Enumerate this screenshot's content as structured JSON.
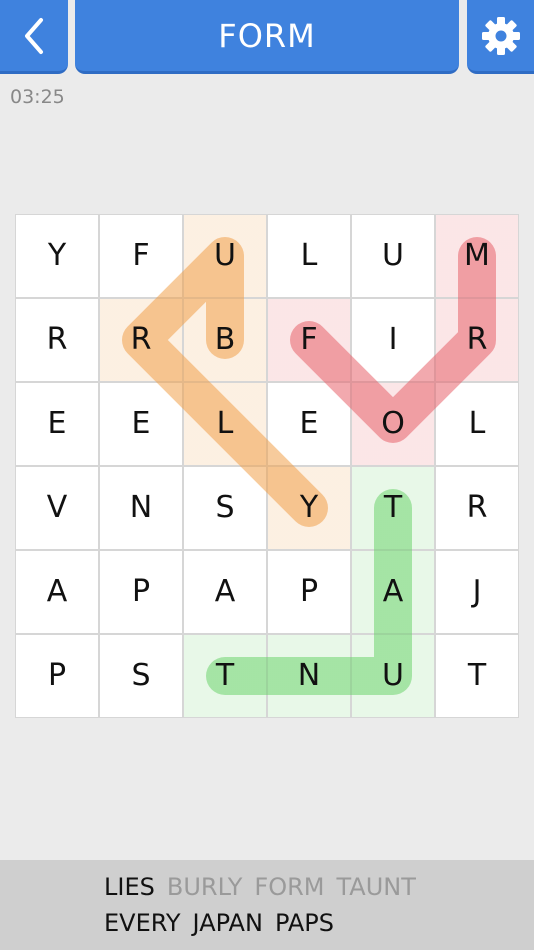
{
  "header": {
    "title": "FORM",
    "back_icon": "chevron-left-icon",
    "settings_icon": "gear-icon"
  },
  "timer": "03:25",
  "colors": {
    "accent": "#3f82de",
    "orange": "#f0a04b",
    "red": "#e8636b",
    "green": "#6ed36e"
  },
  "grid": [
    [
      "Y",
      "F",
      "U",
      "L",
      "U",
      "M"
    ],
    [
      "R",
      "R",
      "B",
      "F",
      "I",
      "R"
    ],
    [
      "E",
      "E",
      "L",
      "E",
      "O",
      "L"
    ],
    [
      "V",
      "N",
      "S",
      "Y",
      "T",
      "R"
    ],
    [
      "A",
      "P",
      "A",
      "P",
      "A",
      "J"
    ],
    [
      "P",
      "S",
      "T",
      "N",
      "U",
      "T"
    ]
  ],
  "found_paths": [
    {
      "word": "BURLY",
      "color": "#f0a04b",
      "cells": [
        [
          1,
          2
        ],
        [
          0,
          2
        ],
        [
          1,
          1
        ],
        [
          2,
          2
        ],
        [
          3,
          3
        ]
      ],
      "line": [
        [
          1,
          2
        ],
        [
          0,
          2
        ],
        [
          1,
          1
        ],
        [
          3,
          3
        ]
      ]
    },
    {
      "word": "FORM",
      "color": "#e8636b",
      "cells": [
        [
          1,
          3
        ],
        [
          2,
          4
        ],
        [
          1,
          5
        ],
        [
          0,
          5
        ]
      ],
      "line": [
        [
          1,
          3
        ],
        [
          2,
          4
        ],
        [
          1,
          5
        ],
        [
          0,
          5
        ]
      ]
    },
    {
      "word": "TAUNT",
      "color": "#6ed36e",
      "cells": [
        [
          3,
          4
        ],
        [
          4,
          4
        ],
        [
          5,
          4
        ],
        [
          5,
          3
        ],
        [
          5,
          2
        ]
      ],
      "line": [
        [
          3,
          4
        ],
        [
          5,
          4
        ],
        [
          5,
          2
        ]
      ]
    }
  ],
  "words": {
    "row1": [
      {
        "text": "LIES",
        "found": false
      },
      {
        "text": "BURLY",
        "found": true
      },
      {
        "text": "FORM",
        "found": true
      },
      {
        "text": "TAUNT",
        "found": true
      }
    ],
    "row2": [
      {
        "text": "EVERY",
        "found": false
      },
      {
        "text": "JAPAN",
        "found": false
      },
      {
        "text": "PAPS",
        "found": false
      }
    ]
  }
}
